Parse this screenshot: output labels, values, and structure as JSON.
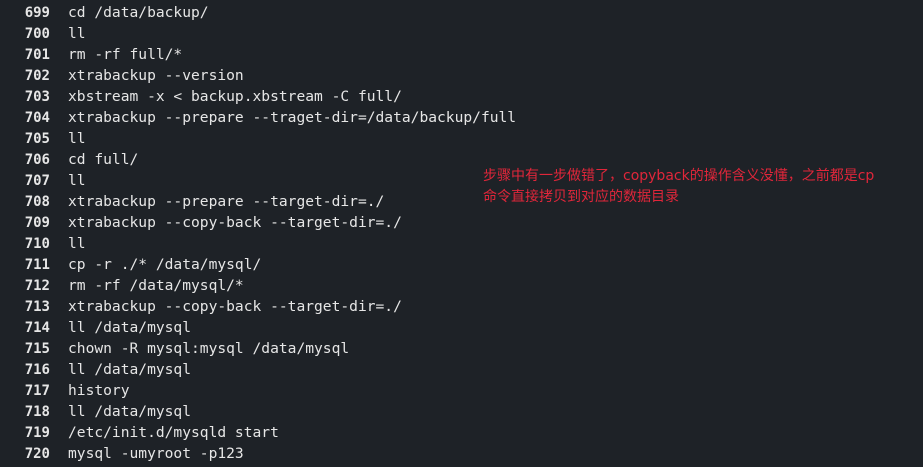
{
  "history": [
    {
      "num": "699",
      "cmd": "cd /data/backup/"
    },
    {
      "num": "700",
      "cmd": "ll"
    },
    {
      "num": "701",
      "cmd": "rm -rf full/*"
    },
    {
      "num": "702",
      "cmd": "xtrabackup --version"
    },
    {
      "num": "703",
      "cmd": "xbstream -x < backup.xbstream -C full/"
    },
    {
      "num": "704",
      "cmd": "xtrabackup --prepare --traget-dir=/data/backup/full"
    },
    {
      "num": "705",
      "cmd": "ll"
    },
    {
      "num": "706",
      "cmd": "cd full/"
    },
    {
      "num": "707",
      "cmd": "ll"
    },
    {
      "num": "708",
      "cmd": "xtrabackup --prepare --target-dir=./"
    },
    {
      "num": "709",
      "cmd": "xtrabackup --copy-back --target-dir=./"
    },
    {
      "num": "710",
      "cmd": "ll"
    },
    {
      "num": "711",
      "cmd": "cp -r ./* /data/mysql/"
    },
    {
      "num": "712",
      "cmd": "rm -rf /data/mysql/*"
    },
    {
      "num": "713",
      "cmd": "xtrabackup --copy-back --target-dir=./"
    },
    {
      "num": "714",
      "cmd": "ll /data/mysql"
    },
    {
      "num": "715",
      "cmd": "chown -R mysql:mysql /data/mysql"
    },
    {
      "num": "716",
      "cmd": "ll /data/mysql"
    },
    {
      "num": "717",
      "cmd": "history"
    },
    {
      "num": "718",
      "cmd": "ll /data/mysql"
    },
    {
      "num": "719",
      "cmd": "/etc/init.d/mysqld start"
    },
    {
      "num": "720",
      "cmd": "mysql -umyroot -p123"
    }
  ],
  "annotation": {
    "line1": "步骤中有一步做错了，copyback的操作含义没懂，之前都是cp",
    "line2": "命令直接拷贝到对应的数据目录",
    "color": "#e0263a"
  },
  "colors": {
    "background": "#1e2227",
    "text": "#e6e6e6"
  }
}
